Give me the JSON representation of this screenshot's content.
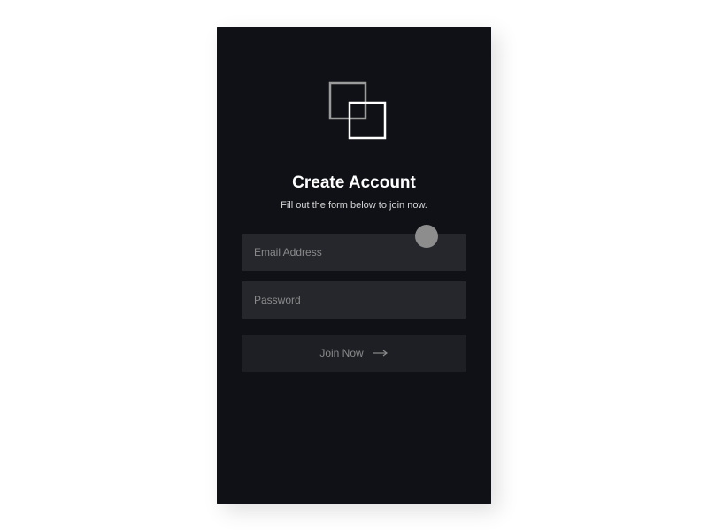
{
  "title": "Create Account",
  "subtitle": "Fill out the form below to join now.",
  "fields": {
    "email": {
      "placeholder": "Email Address",
      "value": ""
    },
    "password": {
      "placeholder": "Password",
      "value": ""
    }
  },
  "button": {
    "label": "Join Now"
  }
}
